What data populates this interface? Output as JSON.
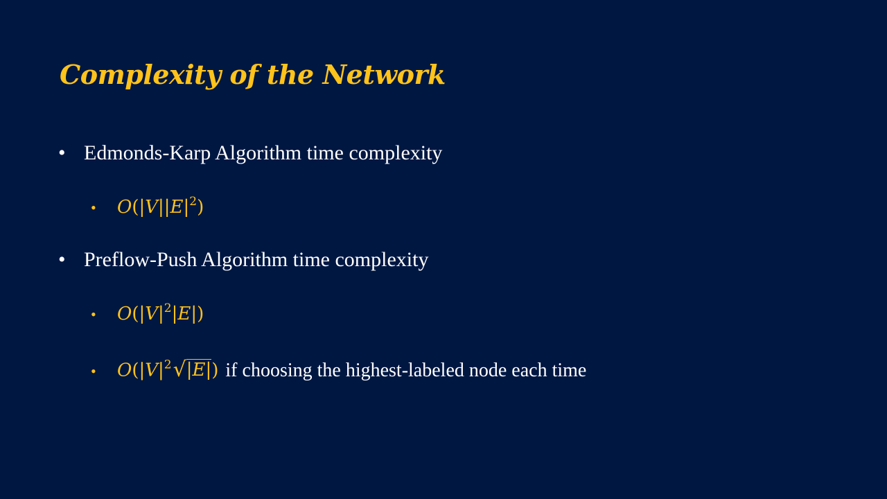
{
  "slide": {
    "title": "Complexity of the Network",
    "bullets": [
      {
        "text": "Edmonds-Karp Algorithm time complexity",
        "sub": [
          {
            "math": "O(|V||E|²)"
          }
        ]
      },
      {
        "text": "Preflow-Push Algorithm time complexity",
        "sub": [
          {
            "math": "O(|V|²|E|)"
          },
          {
            "math": "O(|V|²√(|E|))",
            "text": "if choosing the highest-labeled node each time"
          }
        ]
      }
    ],
    "bullet_glyph": "•"
  },
  "colors": {
    "background": "#001742",
    "accent": "#ffc31a",
    "text": "#ffffff"
  }
}
